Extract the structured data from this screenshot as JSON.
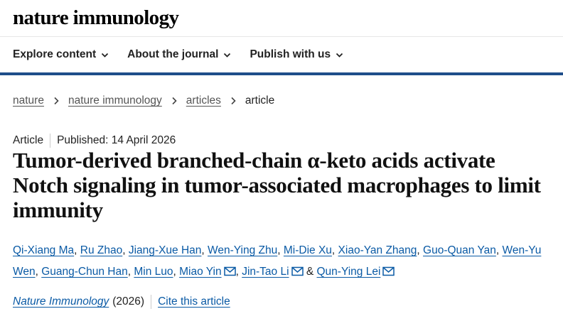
{
  "header": {
    "logo": "nature immunology"
  },
  "nav": {
    "items": [
      {
        "label": "Explore content"
      },
      {
        "label": "About the journal"
      },
      {
        "label": "Publish with us"
      }
    ]
  },
  "breadcrumb": {
    "items": [
      "nature",
      "nature immunology",
      "articles"
    ],
    "current": "article"
  },
  "article": {
    "type": "Article",
    "published": "Published: 14 April 2026",
    "title": "Tumor-derived branched-chain α-keto acids activate Notch signaling in tumor-associated macrophages to limit immunity",
    "authors": [
      "Qi-Xiang Ma",
      "Ru Zhao",
      "Jiang-Xue Han",
      "Wen-Ying Zhu",
      "Mi-Die Xu",
      "Xiao-Yan Zhang",
      "Guo-Quan Yan",
      "Wen-Yu Wen",
      "Guang-Chun Han",
      "Min Luo",
      "Miao Yin",
      "Jin-Tao Li",
      "Qun-Ying Lei"
    ],
    "journal": "Nature Immunology",
    "year": "(2026)",
    "cite_label": "Cite this article"
  },
  "colors": {
    "link": "#0a5aa5",
    "nav_border": "#1f4e8a"
  }
}
